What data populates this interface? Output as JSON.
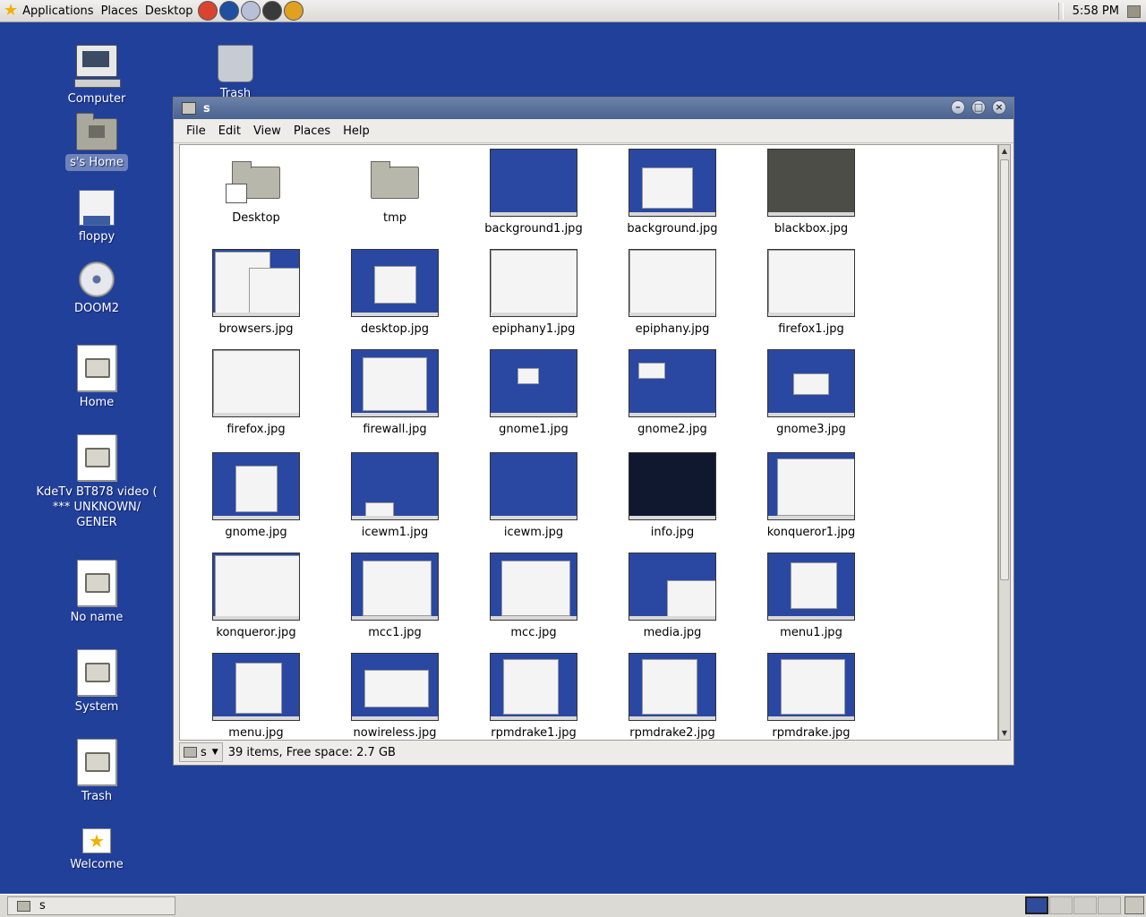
{
  "top_panel": {
    "menus": [
      "Applications",
      "Places",
      "Desktop"
    ],
    "launchers": [
      {
        "name": "help-launcher-icon",
        "color": "#d9432f"
      },
      {
        "name": "browser-launcher-icon",
        "color": "#1f4fa0"
      },
      {
        "name": "email-launcher-icon",
        "color": "#b8c0d8"
      },
      {
        "name": "terminal-launcher-icon",
        "color": "#3a3a3a"
      },
      {
        "name": "update-launcher-icon",
        "color": "#e0a020"
      }
    ],
    "clock": "5:58 PM"
  },
  "desktop_icons": [
    {
      "label": "Computer",
      "kind": "computer"
    },
    {
      "label": "s's Home",
      "kind": "home",
      "selected": true
    },
    {
      "label": "floppy",
      "kind": "floppy"
    },
    {
      "label": "DOOM2",
      "kind": "disc"
    },
    {
      "label": "Home",
      "kind": "doc"
    },
    {
      "label": "KdeTv BT878 video ( *** UNKNOWN/ GENER",
      "kind": "doc"
    },
    {
      "label": "No name",
      "kind": "doc"
    },
    {
      "label": "System",
      "kind": "doc"
    },
    {
      "label": "Trash",
      "kind": "doc"
    },
    {
      "label": "Welcome",
      "kind": "welcome"
    },
    {
      "label": "Trash",
      "kind": "trash"
    }
  ],
  "window": {
    "title": "s",
    "menu": [
      "File",
      "Edit",
      "View",
      "Places",
      "Help"
    ],
    "items": [
      {
        "name": "Desktop",
        "type": "folder"
      },
      {
        "name": "tmp",
        "type": "folder"
      },
      {
        "name": "background1.jpg",
        "type": "image"
      },
      {
        "name": "background.jpg",
        "type": "image"
      },
      {
        "name": "blackbox.jpg",
        "type": "image"
      },
      {
        "name": "browsers.jpg",
        "type": "image"
      },
      {
        "name": "desktop.jpg",
        "type": "image"
      },
      {
        "name": "epiphany1.jpg",
        "type": "image"
      },
      {
        "name": "epiphany.jpg",
        "type": "image"
      },
      {
        "name": "firefox1.jpg",
        "type": "image"
      },
      {
        "name": "firefox.jpg",
        "type": "image"
      },
      {
        "name": "firewall.jpg",
        "type": "image"
      },
      {
        "name": "gnome1.jpg",
        "type": "image"
      },
      {
        "name": "gnome2.jpg",
        "type": "image"
      },
      {
        "name": "gnome3.jpg",
        "type": "image"
      },
      {
        "name": "gnome.jpg",
        "type": "image"
      },
      {
        "name": "icewm1.jpg",
        "type": "image"
      },
      {
        "name": "icewm.jpg",
        "type": "image"
      },
      {
        "name": "info.jpg",
        "type": "image"
      },
      {
        "name": "konqueror1.jpg",
        "type": "image"
      },
      {
        "name": "konqueror.jpg",
        "type": "image"
      },
      {
        "name": "mcc1.jpg",
        "type": "image"
      },
      {
        "name": "mcc.jpg",
        "type": "image"
      },
      {
        "name": "media.jpg",
        "type": "image"
      },
      {
        "name": "menu1.jpg",
        "type": "image"
      },
      {
        "name": "menu.jpg",
        "type": "image"
      },
      {
        "name": "nowireless.jpg",
        "type": "image"
      },
      {
        "name": "rpmdrake1.jpg",
        "type": "image"
      },
      {
        "name": "rpmdrake2.jpg",
        "type": "image"
      },
      {
        "name": "rpmdrake.jpg",
        "type": "image"
      }
    ],
    "location": "s",
    "status": "39 items, Free space: 2.7 GB"
  },
  "bottom_panel": {
    "task_label": "s",
    "workspaces": 4,
    "active_workspace": 1
  }
}
